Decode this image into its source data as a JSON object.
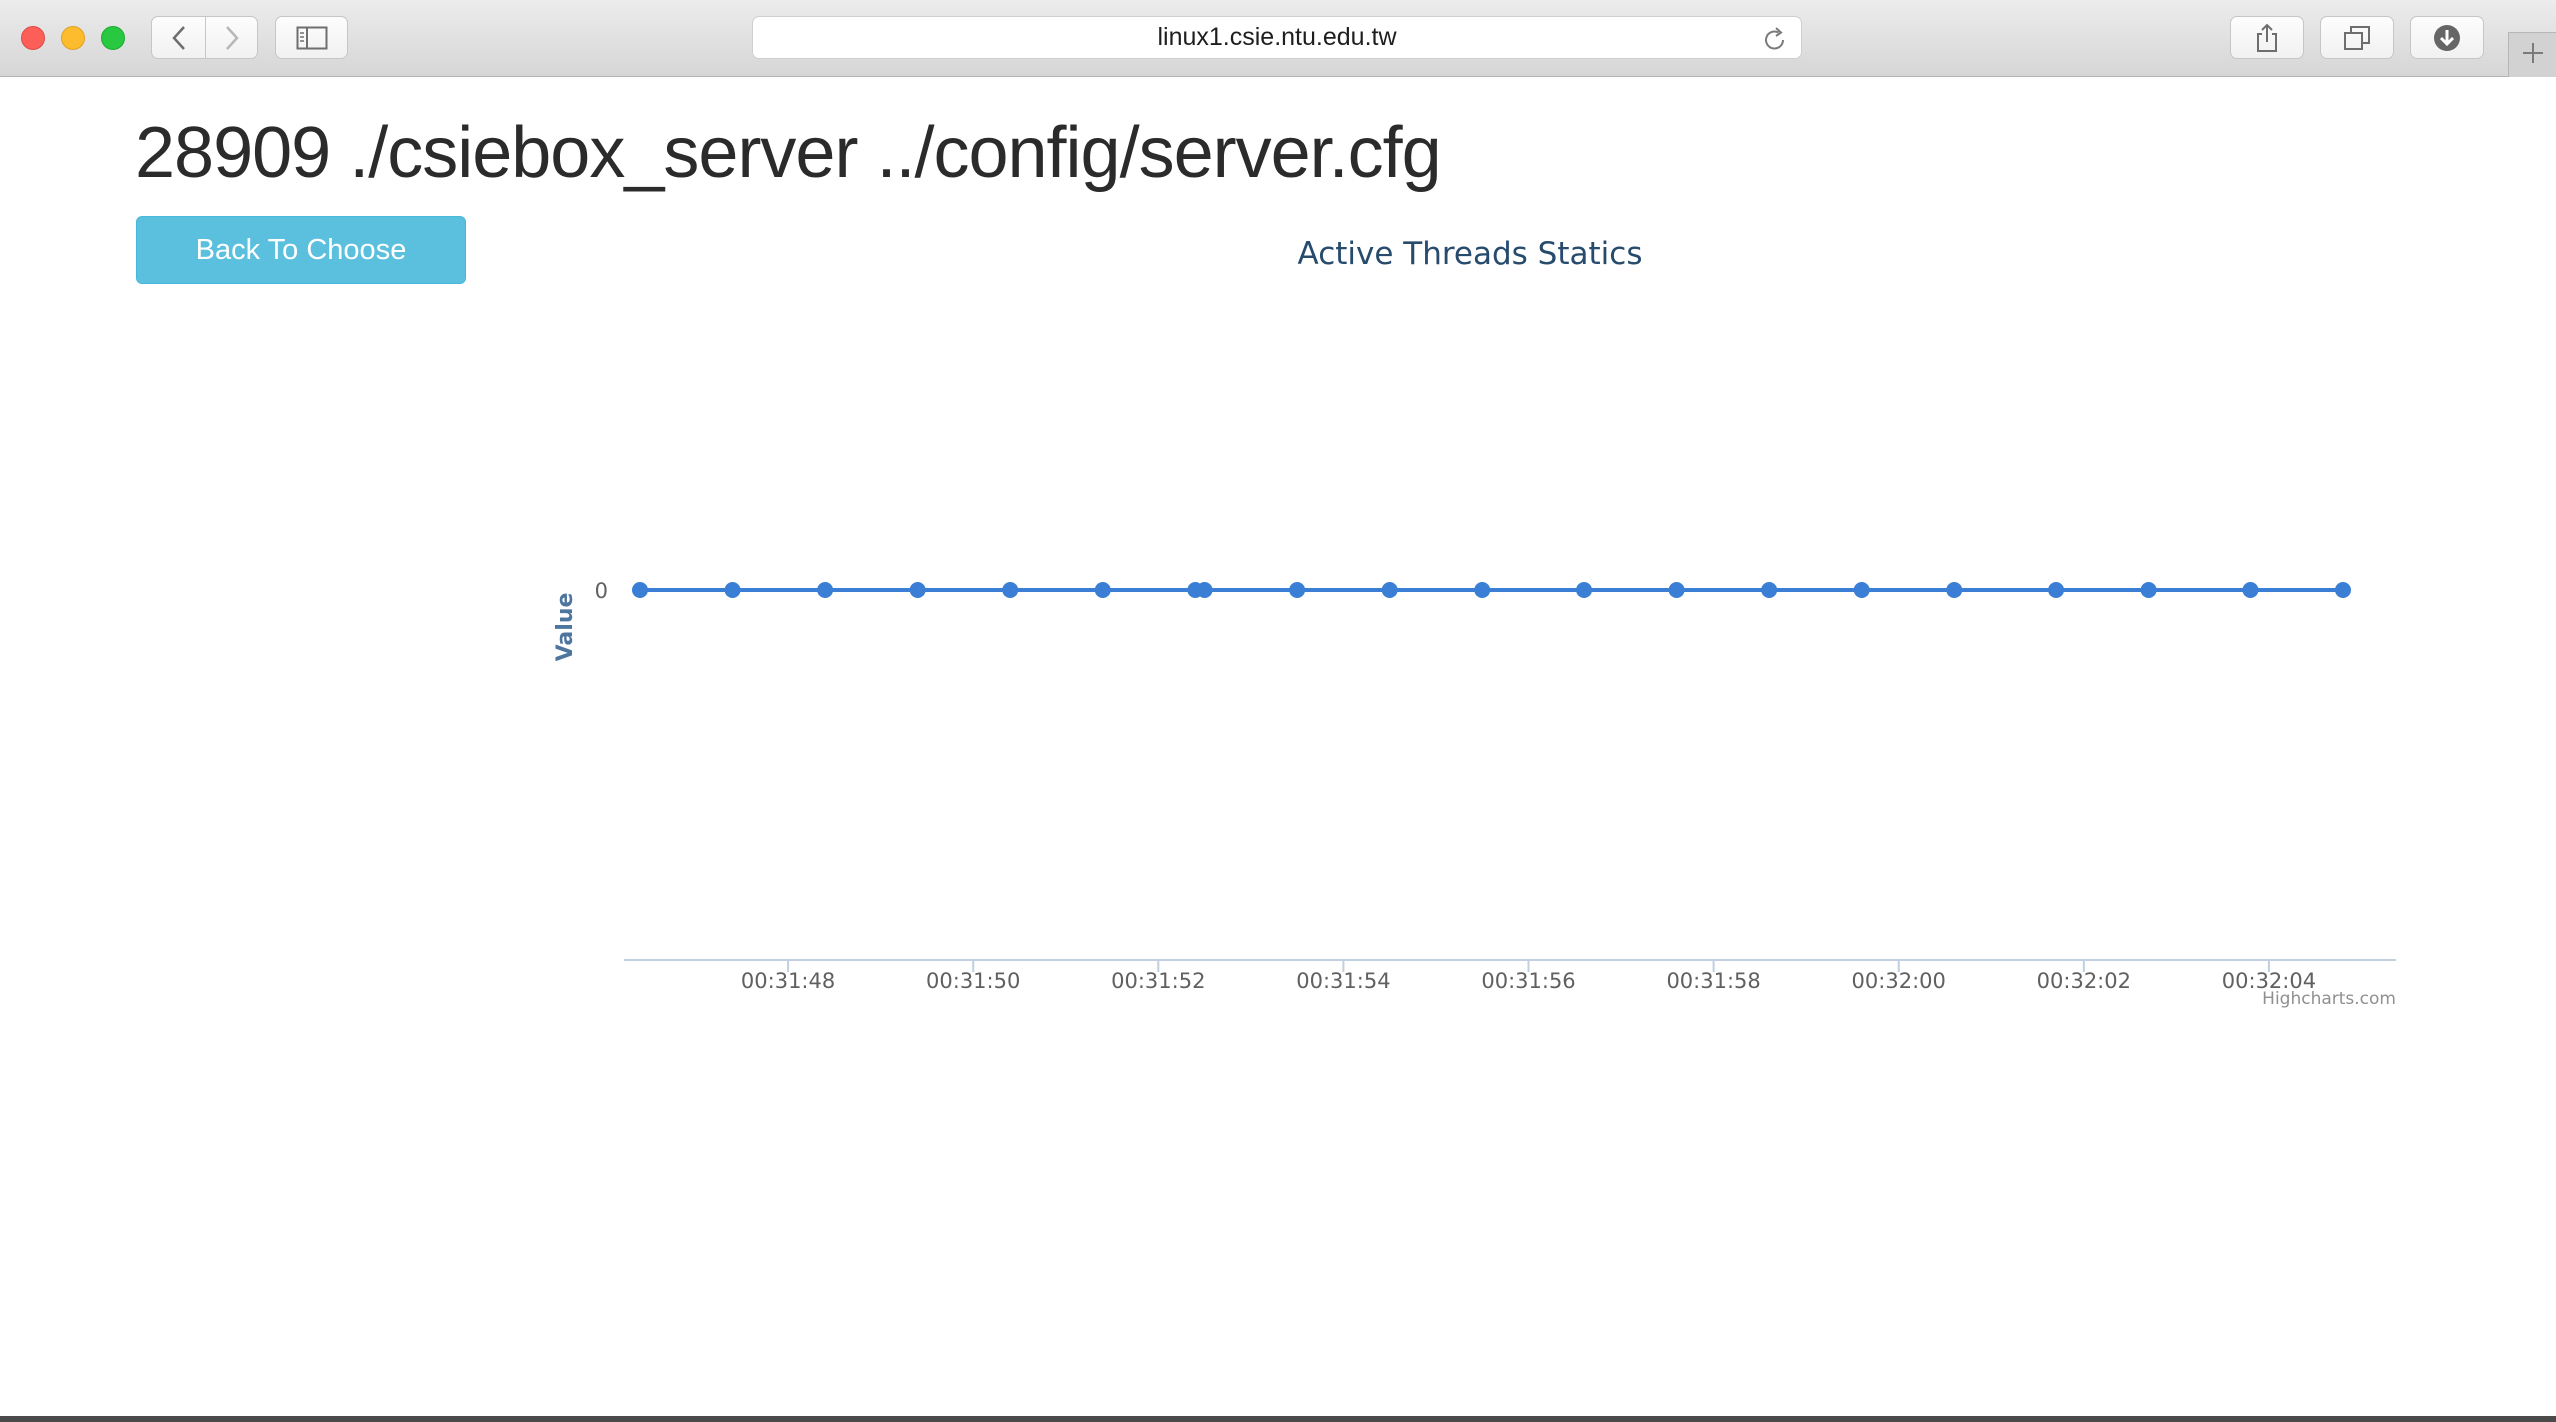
{
  "browser": {
    "url": "linux1.csie.ntu.edu.tw",
    "icons": {
      "back": "chevron-left-icon",
      "forward": "chevron-right-icon",
      "sidebar": "sidebar-icon",
      "reload": "reload-icon",
      "share": "share-icon",
      "tabs": "tabs-icon",
      "download": "download-icon",
      "new_tab": "plus-icon"
    }
  },
  "page": {
    "title": "28909 ./csiebox_server ../config/server.cfg",
    "back_button": "Back To Choose"
  },
  "colors": {
    "button": "#5bc0de",
    "series": "#3a7fd5",
    "chart_title": "#274b6d",
    "axis_title": "#4d759e"
  },
  "chart_data": {
    "type": "line",
    "title": "Active Threads Statics",
    "ylabel": "Value",
    "xlabel": "",
    "y_ticks": [
      "0"
    ],
    "x_ticks": [
      "00:31:48",
      "00:31:50",
      "00:31:52",
      "00:31:54",
      "00:31:56",
      "00:31:58",
      "00:32:00",
      "00:32:02",
      "00:32:04"
    ],
    "x_range": [
      "00:31:46.4",
      "00:32:05.2"
    ],
    "ylim": [
      -1,
      1
    ],
    "grid": false,
    "legend": "none",
    "credit": "Highcharts.com",
    "series": [
      {
        "x": [
          "00:31:46.4",
          "00:31:47.4",
          "00:31:48.4",
          "00:31:49.4",
          "00:31:50.4",
          "00:31:51.4",
          "00:31:52.4",
          "00:31:52.5",
          "00:31:53.5",
          "00:31:54.5",
          "00:31:55.5",
          "00:31:56.6",
          "00:31:57.6",
          "00:31:58.6",
          "00:31:59.6",
          "00:32:00.6",
          "00:32:01.7",
          "00:32:02.7",
          "00:32:03.8",
          "00:32:04.8"
        ],
        "values": [
          0,
          0,
          0,
          0,
          0,
          0,
          0,
          0,
          0,
          0,
          0,
          0,
          0,
          0,
          0,
          0,
          0,
          0,
          0,
          0
        ]
      }
    ]
  }
}
